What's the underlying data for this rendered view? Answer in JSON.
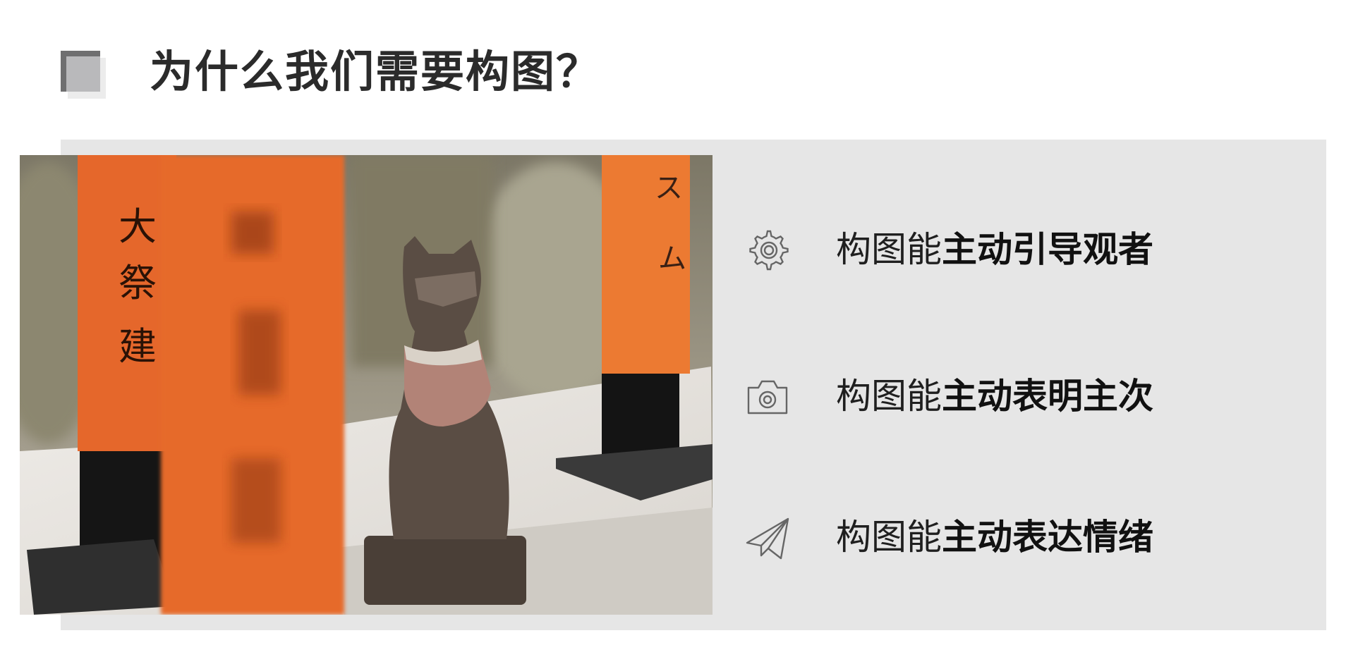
{
  "header": {
    "title": "为什么我们需要构图？"
  },
  "photo": {
    "description_icon": "photo-fox-statue-torii"
  },
  "features": [
    {
      "icon": "gear-icon",
      "prefix": "构图能",
      "emphasis": "主动引导观者"
    },
    {
      "icon": "camera-icon",
      "prefix": "构图能",
      "emphasis": "主动表明主次"
    },
    {
      "icon": "paper-plane-icon",
      "prefix": "构图能",
      "emphasis": "主动表达情绪"
    }
  ],
  "colors": {
    "panel": "#e6e6e6",
    "title": "#2b2b2b",
    "mark_dark": "#6f6f70",
    "mark_light": "#b9b9bb",
    "torii_orange": "#e0622a"
  }
}
